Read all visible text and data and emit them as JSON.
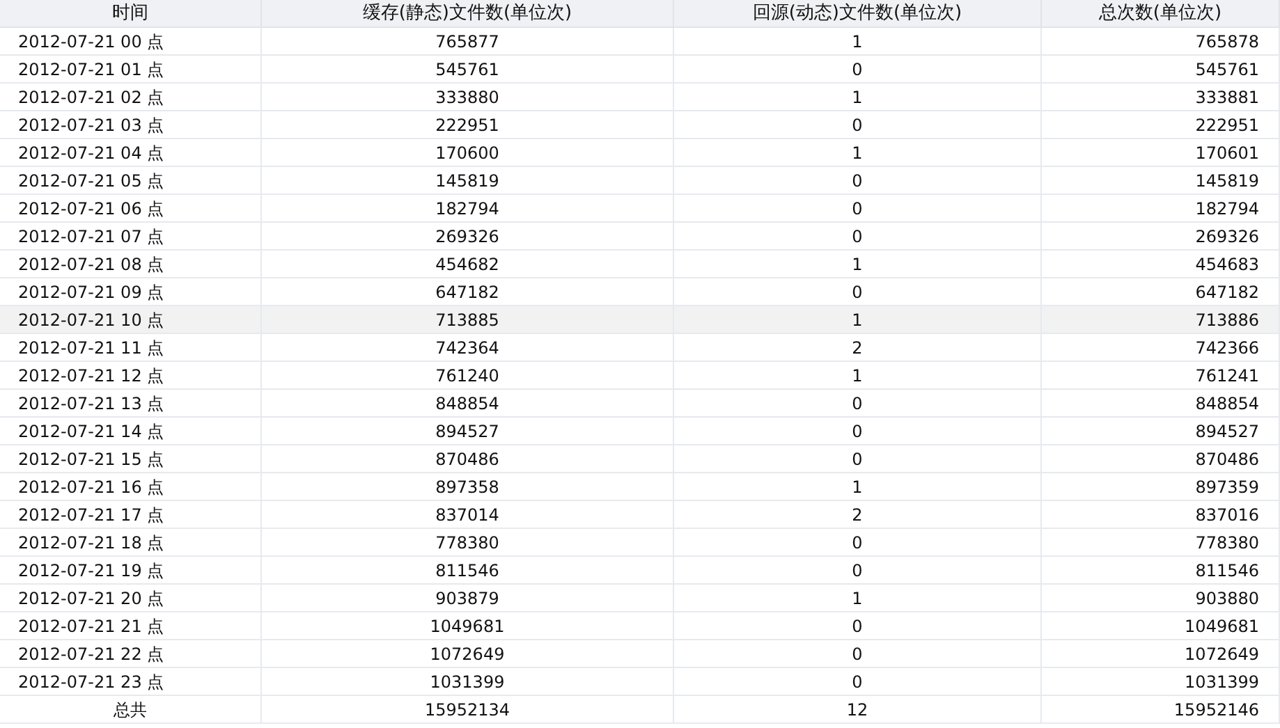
{
  "table": {
    "columns": [
      "时间",
      "缓存(静态)文件数(单位次)",
      "回源(动态)文件数(单位次)",
      "总次数(单位次)"
    ],
    "rows": [
      {
        "cells": [
          "2012-07-21 00 点",
          "765877",
          "1",
          "765878"
        ],
        "selected": false
      },
      {
        "cells": [
          "2012-07-21 01 点",
          "545761",
          "0",
          "545761"
        ],
        "selected": false
      },
      {
        "cells": [
          "2012-07-21 02 点",
          "333880",
          "1",
          "333881"
        ],
        "selected": false
      },
      {
        "cells": [
          "2012-07-21 03 点",
          "222951",
          "0",
          "222951"
        ],
        "selected": false
      },
      {
        "cells": [
          "2012-07-21 04 点",
          "170600",
          "1",
          "170601"
        ],
        "selected": false
      },
      {
        "cells": [
          "2012-07-21 05 点",
          "145819",
          "0",
          "145819"
        ],
        "selected": false
      },
      {
        "cells": [
          "2012-07-21 06 点",
          "182794",
          "0",
          "182794"
        ],
        "selected": false
      },
      {
        "cells": [
          "2012-07-21 07 点",
          "269326",
          "0",
          "269326"
        ],
        "selected": false
      },
      {
        "cells": [
          "2012-07-21 08 点",
          "454682",
          "1",
          "454683"
        ],
        "selected": false
      },
      {
        "cells": [
          "2012-07-21 09 点",
          "647182",
          "0",
          "647182"
        ],
        "selected": false
      },
      {
        "cells": [
          "2012-07-21 10 点",
          "713885",
          "1",
          "713886"
        ],
        "selected": true
      },
      {
        "cells": [
          "2012-07-21 11 点",
          "742364",
          "2",
          "742366"
        ],
        "selected": false
      },
      {
        "cells": [
          "2012-07-21 12 点",
          "761240",
          "1",
          "761241"
        ],
        "selected": false
      },
      {
        "cells": [
          "2012-07-21 13 点",
          "848854",
          "0",
          "848854"
        ],
        "selected": false
      },
      {
        "cells": [
          "2012-07-21 14 点",
          "894527",
          "0",
          "894527"
        ],
        "selected": false
      },
      {
        "cells": [
          "2012-07-21 15 点",
          "870486",
          "0",
          "870486"
        ],
        "selected": false
      },
      {
        "cells": [
          "2012-07-21 16 点",
          "897358",
          "1",
          "897359"
        ],
        "selected": false
      },
      {
        "cells": [
          "2012-07-21 17 点",
          "837014",
          "2",
          "837016"
        ],
        "selected": false
      },
      {
        "cells": [
          "2012-07-21 18 点",
          "778380",
          "0",
          "778380"
        ],
        "selected": false
      },
      {
        "cells": [
          "2012-07-21 19 点",
          "811546",
          "0",
          "811546"
        ],
        "selected": false
      },
      {
        "cells": [
          "2012-07-21 20 点",
          "903879",
          "1",
          "903880"
        ],
        "selected": false
      },
      {
        "cells": [
          "2012-07-21 21 点",
          "1049681",
          "0",
          "1049681"
        ],
        "selected": false
      },
      {
        "cells": [
          "2012-07-21 22 点",
          "1072649",
          "0",
          "1072649"
        ],
        "selected": false
      },
      {
        "cells": [
          "2012-07-21 23 点",
          "1031399",
          "0",
          "1031399"
        ],
        "selected": false
      }
    ],
    "total": [
      "总共",
      "15952134",
      "12",
      "15952146"
    ]
  }
}
